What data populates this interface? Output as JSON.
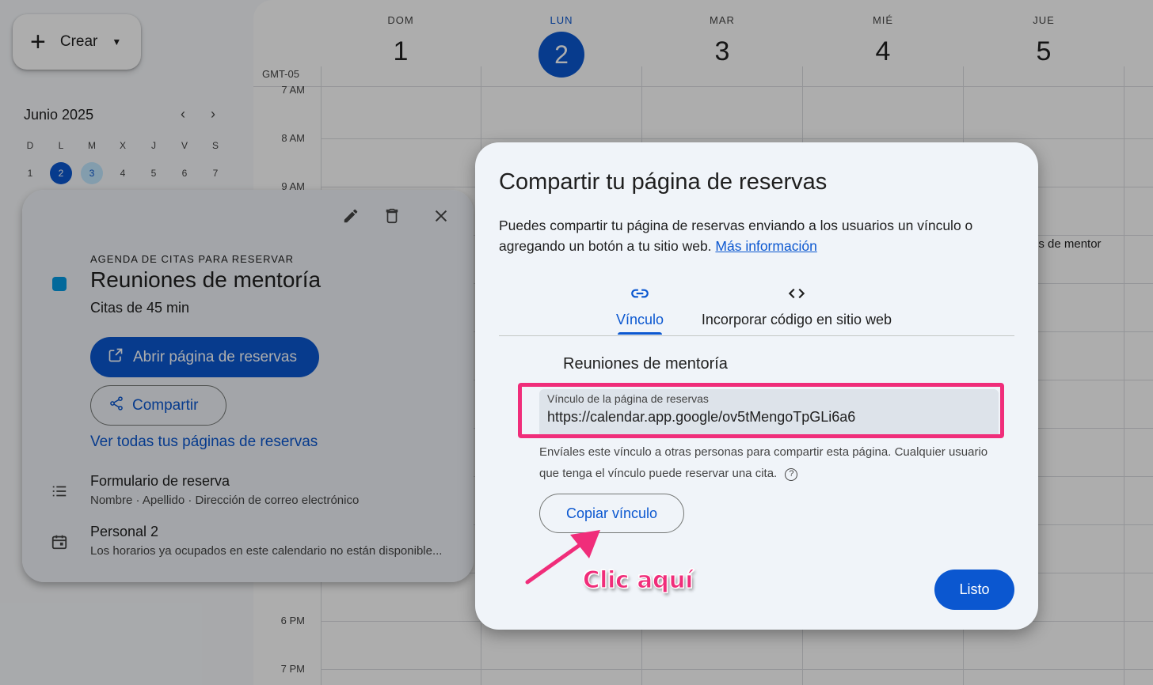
{
  "sidebar": {
    "create_label": "Crear",
    "mini_calendar": {
      "month": "Junio 2025",
      "weekdays": [
        "D",
        "L",
        "M",
        "X",
        "J",
        "V",
        "S"
      ],
      "days": [
        "1",
        "2",
        "3",
        "4",
        "5",
        "6",
        "7"
      ],
      "today": "2",
      "selected": "3"
    }
  },
  "calendar": {
    "timezone": "GMT-05",
    "days": [
      {
        "dow": "DOM",
        "date": "1"
      },
      {
        "dow": "LUN",
        "date": "2"
      },
      {
        "dow": "MAR",
        "date": "3"
      },
      {
        "dow": "MIÉ",
        "date": "4"
      },
      {
        "dow": "JUE",
        "date": "5"
      }
    ],
    "hours": [
      "7 AM",
      "8 AM",
      "9 AM",
      "6 PM",
      "7 PM"
    ],
    "event_fragment": "es de mentor"
  },
  "event_details": {
    "kicker": "AGENDA DE CITAS PARA RESERVAR",
    "title": "Reuniones de mentoría",
    "subtitle": "Citas de 45 min",
    "open_label": "Abrir página de reservas",
    "share_label": "Compartir",
    "all_pages_label": "Ver todas tus páginas de reservas",
    "form_title": "Formulario de reserva",
    "form_fields": "Nombre · Apellido · Dirección de correo electrónico",
    "calendar_title": "Personal 2",
    "calendar_note": "Los horarios ya ocupados en este calendario no están disponible..."
  },
  "share_dialog": {
    "title": "Compartir tu página de reservas",
    "description": "Puedes compartir tu página de reservas enviando a los usuarios un vínculo o agregando un botón a tu sitio web.",
    "learn_more": "Más información",
    "tabs": [
      {
        "label": "Vínculo",
        "icon": "link-icon",
        "active": true
      },
      {
        "label": "Incorporar código en sitio web",
        "icon": "code-icon",
        "active": false
      }
    ],
    "page_name": "Reuniones de mentoría",
    "link_label": "Vínculo de la página de reservas",
    "link_value": "https://calendar.app.google/ov5tMengoTpGLi6a6",
    "help_text": "Envíales este vínculo a otras personas para compartir esta página. Cualquier usuario que tenga el vínculo puede reservar una cita.",
    "copy_label": "Copiar vínculo",
    "done_label": "Listo"
  },
  "annotation": {
    "text": "Clic aquí",
    "color": "#f02d7a"
  },
  "colors": {
    "primary": "#0b57d0",
    "event": "#039be5",
    "highlight": "#f02d7a"
  }
}
